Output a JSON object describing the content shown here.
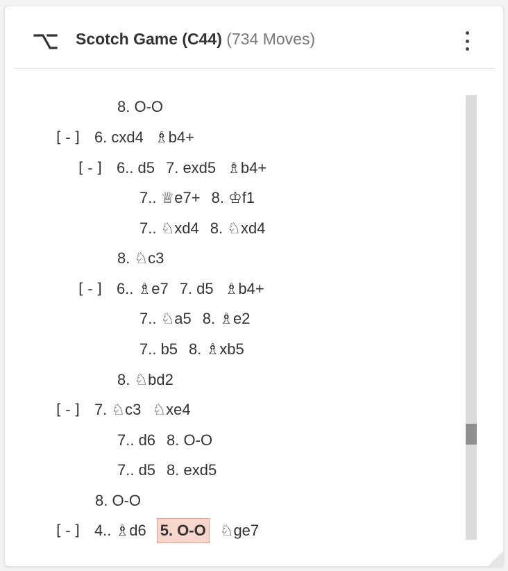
{
  "header": {
    "title": "Scotch Game (C44)",
    "subtitle": "(734 Moves)",
    "icon": "alt-branch-icon",
    "menu_icon": "kebab-menu-icon"
  },
  "colors": {
    "current_move_bg": "#f7d6cc",
    "current_move_border": "#ef9c86",
    "text": "#333333",
    "subtitle": "#777777"
  },
  "tree": {
    "collapse_label": "[-]",
    "rows": [
      {
        "toggle": false,
        "moves": [
          "8. O-O"
        ]
      },
      {
        "toggle": true,
        "moves": [
          "6. cxd4",
          "♗b4+"
        ]
      },
      {
        "toggle": true,
        "moves": [
          "6.. d5",
          "7. exd5",
          "♗b4+"
        ]
      },
      {
        "toggle": false,
        "moves": [
          "7.. ♕e7+",
          "8. ♔f1"
        ]
      },
      {
        "toggle": false,
        "moves": [
          "7.. ♘xd4",
          "8. ♘xd4"
        ]
      },
      {
        "toggle": false,
        "moves": [
          "8. ♘c3"
        ]
      },
      {
        "toggle": true,
        "moves": [
          "6.. ♗e7",
          "7. d5",
          "♗b4+"
        ]
      },
      {
        "toggle": false,
        "moves": [
          "7.. ♘a5",
          "8. ♗e2"
        ]
      },
      {
        "toggle": false,
        "moves": [
          "7.. b5",
          "8. ♗xb5"
        ]
      },
      {
        "toggle": false,
        "moves": [
          "8. ♘bd2"
        ]
      },
      {
        "toggle": true,
        "moves": [
          "7. ♘c3",
          "♘xe4"
        ]
      },
      {
        "toggle": false,
        "moves": [
          "7.. d6",
          "8. O-O"
        ]
      },
      {
        "toggle": false,
        "moves": [
          "7.. d5",
          "8. exd5"
        ]
      },
      {
        "toggle": false,
        "moves": [
          "8. O-O"
        ]
      },
      {
        "toggle": true,
        "moves": [
          "4.. ♗d6",
          "5. O-O",
          "♘ge7"
        ],
        "current_index": 1
      }
    ]
  }
}
